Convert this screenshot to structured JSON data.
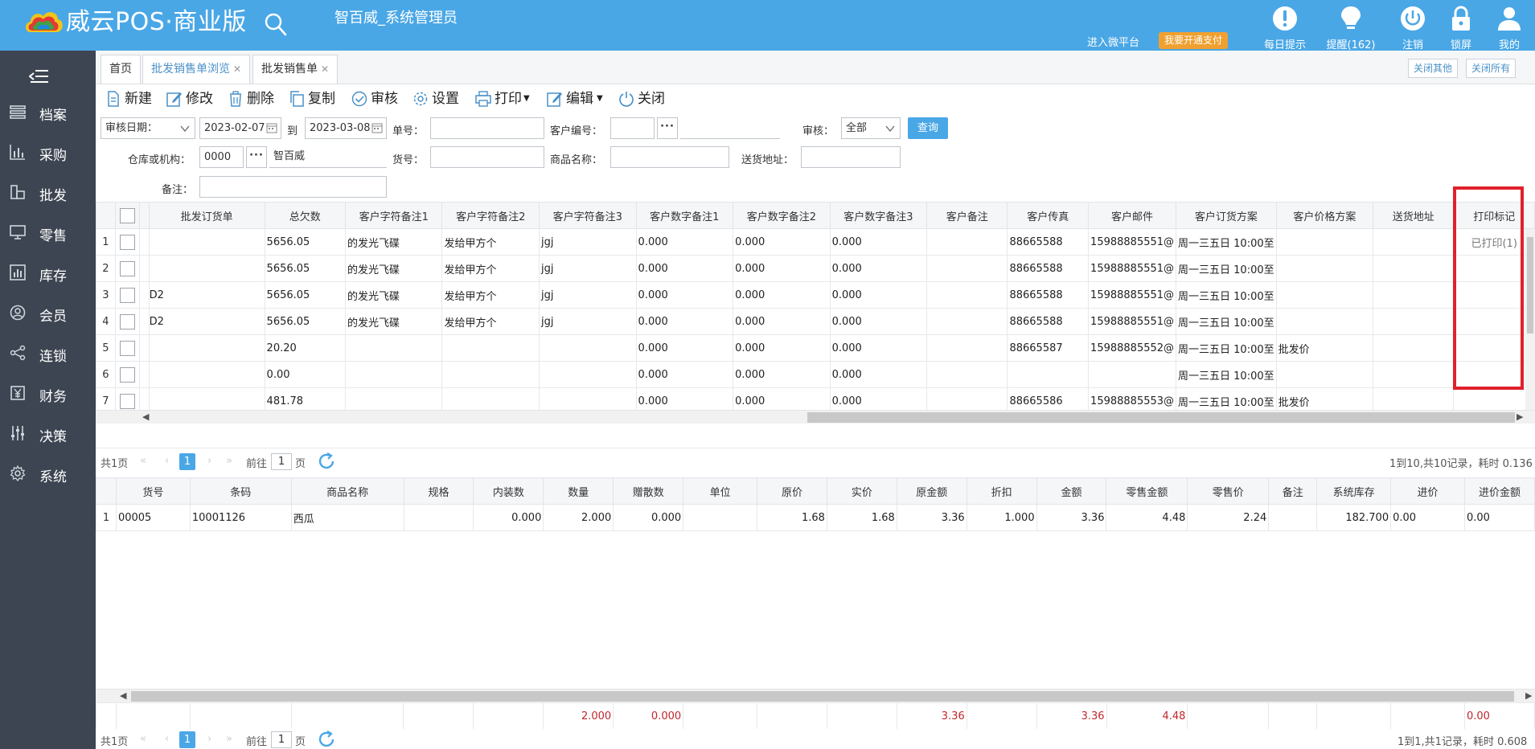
{
  "header": {
    "brand": "威云POS·商业版",
    "user_title": "智百威_系统管理员",
    "micro_platform": "进入微平台",
    "pay_badge": "我要开通支付",
    "icons": [
      {
        "name": "daily-tip-icon",
        "label": "每日提示"
      },
      {
        "name": "reminder-icon",
        "label": "提醒(162)"
      },
      {
        "name": "logout-icon",
        "label": "注销"
      },
      {
        "name": "lock-icon",
        "label": "锁屏"
      },
      {
        "name": "user-icon",
        "label": "我的"
      }
    ]
  },
  "sidebar": {
    "items": [
      {
        "label": "档案",
        "icon": "archive-icon"
      },
      {
        "label": "采购",
        "icon": "purchase-chart-icon"
      },
      {
        "label": "批发",
        "icon": "wholesale-icon"
      },
      {
        "label": "零售",
        "icon": "monitor-icon"
      },
      {
        "label": "库存",
        "icon": "stock-chart-icon"
      },
      {
        "label": "会员",
        "icon": "member-icon"
      },
      {
        "label": "连锁",
        "icon": "share-icon"
      },
      {
        "label": "财务",
        "icon": "finance-icon"
      },
      {
        "label": "决策",
        "icon": "sliders-icon"
      },
      {
        "label": "系统",
        "icon": "gear-icon"
      }
    ]
  },
  "tabs": {
    "items": [
      "首页",
      "批发销售单浏览",
      "批发销售单"
    ],
    "close_others": "关闭其他",
    "close_all": "关闭所有"
  },
  "toolbar": {
    "new": "新建",
    "edit": "修改",
    "delete": "删除",
    "copy": "复制",
    "audit": "审核",
    "settings": "设置",
    "print": "打印",
    "editmenu": "编辑",
    "close": "关闭"
  },
  "filters": {
    "date_type": "审核日期：",
    "date_from": "2023-02-07",
    "to": "到",
    "date_to": "2023-03-08",
    "order_no_label": "单号：",
    "customer_no_label": "客户编号：",
    "audit_label": "审核：",
    "audit_value": "全部",
    "query": "查询",
    "warehouse_label": "仓库或机构：",
    "warehouse_code": "0000",
    "warehouse_name": "智百威",
    "item_no_label": "货号：",
    "item_name_label": "商品名称：",
    "address_label": "送货地址：",
    "remark_label": "备注："
  },
  "main_grid": {
    "headers": [
      "批发订货单",
      "总欠数",
      "客户字符备注1",
      "客户字符备注2",
      "客户字符备注3",
      "客户数字备注1",
      "客户数字备注2",
      "客户数字备注3",
      "客户备注",
      "客户传真",
      "客户邮件",
      "客户订货方案",
      "客户价格方案",
      "送货地址",
      "打印标记"
    ],
    "rows": [
      {
        "n": "1",
        "order": "",
        "owed": "5656.05",
        "c1": "的发光飞碟",
        "c2": "发给甲方个",
        "c3": "jgj",
        "d1": "0.000",
        "d2": "0.000",
        "d3": "0.000",
        "memo": "",
        "fax": "88665588",
        "mail": "15988885551@",
        "plan": "周一三五日 10:00至",
        "price": "",
        "addr": "",
        "print": "已打印(1)"
      },
      {
        "n": "2",
        "order": "",
        "owed": "5656.05",
        "c1": "的发光飞碟",
        "c2": "发给甲方个",
        "c3": "jgj",
        "d1": "0.000",
        "d2": "0.000",
        "d3": "0.000",
        "memo": "",
        "fax": "88665588",
        "mail": "15988885551@",
        "plan": "周一三五日 10:00至",
        "price": "",
        "addr": "",
        "print": ""
      },
      {
        "n": "3",
        "order": "D2",
        "owed": "5656.05",
        "c1": "的发光飞碟",
        "c2": "发给甲方个",
        "c3": "jgj",
        "d1": "0.000",
        "d2": "0.000",
        "d3": "0.000",
        "memo": "",
        "fax": "88665588",
        "mail": "15988885551@",
        "plan": "周一三五日 10:00至",
        "price": "",
        "addr": "",
        "print": ""
      },
      {
        "n": "4",
        "order": "D2",
        "owed": "5656.05",
        "c1": "的发光飞碟",
        "c2": "发给甲方个",
        "c3": "jgj",
        "d1": "0.000",
        "d2": "0.000",
        "d3": "0.000",
        "memo": "",
        "fax": "88665588",
        "mail": "15988885551@",
        "plan": "周一三五日 10:00至",
        "price": "",
        "addr": "",
        "print": ""
      },
      {
        "n": "5",
        "order": "",
        "owed": "20.20",
        "c1": "",
        "c2": "",
        "c3": "",
        "d1": "0.000",
        "d2": "0.000",
        "d3": "0.000",
        "memo": "",
        "fax": "88665587",
        "mail": "15988885552@",
        "plan": "周一三五日 10:00至",
        "price": "批发价",
        "addr": "",
        "print": ""
      },
      {
        "n": "6",
        "order": "",
        "owed": "0.00",
        "c1": "",
        "c2": "",
        "c3": "",
        "d1": "0.000",
        "d2": "0.000",
        "d3": "0.000",
        "memo": "",
        "fax": "",
        "mail": "",
        "plan": "周一三五日 10:00至",
        "price": "",
        "addr": "",
        "print": ""
      },
      {
        "n": "7",
        "order": "",
        "owed": "481.78",
        "c1": "",
        "c2": "",
        "c3": "",
        "d1": "0.000",
        "d2": "0.000",
        "d3": "0.000",
        "memo": "",
        "fax": "88665586",
        "mail": "15988885553@",
        "plan": "周一三五日 10:00至",
        "price": "批发价",
        "addr": "",
        "print": ""
      }
    ]
  },
  "pager1": {
    "total_pages": "共1页",
    "current": "1",
    "goto": "前往",
    "page_input": "1",
    "page_unit": "页",
    "summary": "1到10,共10记录，耗时 0.136"
  },
  "detail_grid": {
    "headers": [
      "货号",
      "条码",
      "商品名称",
      "规格",
      "内装数",
      "数量",
      "赠散数",
      "单位",
      "原价",
      "实价",
      "原金额",
      "折扣",
      "金额",
      "零售金额",
      "零售价",
      "备注",
      "系统库存",
      "进价",
      "进价金额"
    ],
    "rows": [
      {
        "n": "1",
        "item_no": "00005",
        "barcode": "10001126",
        "name": "西瓜",
        "spec": "",
        "inner": "0.000",
        "qty": "2.000",
        "gift": "0.000",
        "unit": "",
        "orig_price": "1.68",
        "price": "1.68",
        "orig_amt": "3.36",
        "disc": "1.000",
        "amt": "3.36",
        "retail_amt": "4.48",
        "retail_price": "2.24",
        "memo": "",
        "stock": "182.700",
        "cost": "0.00",
        "cost_amt": "0.00"
      }
    ],
    "totals": {
      "qty": "2.000",
      "gift": "0.000",
      "orig_amt": "3.36",
      "amt": "3.36",
      "retail_amt": "4.48",
      "cost_amt": "0.00"
    }
  },
  "pager2": {
    "total_pages": "共1页",
    "current": "1",
    "goto": "前往",
    "page_input": "1",
    "page_unit": "页",
    "summary": "1到1,共1记录，耗时 0.608"
  },
  "colors": {
    "header_bg": "#4aa7e6",
    "sidebar_bg": "#3d4552",
    "highlight": "#e0212b",
    "total_red": "#c0272d"
  }
}
